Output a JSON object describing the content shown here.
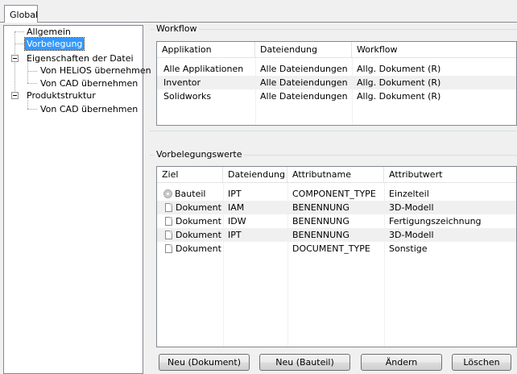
{
  "tab": {
    "label": "Global"
  },
  "tree": {
    "items": [
      {
        "label": "Allgemein"
      },
      {
        "label": "Vorbelegung"
      },
      {
        "label": "Eigenschaften der Datei"
      },
      {
        "label": "Von HELiOS übernehmen"
      },
      {
        "label": "Von CAD übernehmen"
      },
      {
        "label": "Produktstruktur"
      },
      {
        "label": "Von CAD übernehmen"
      }
    ]
  },
  "workflow": {
    "title": "Workflow",
    "columns": [
      "Applikation",
      "Dateiendung",
      "Workflow"
    ],
    "rows": [
      [
        "Alle Applikationen",
        "Alle Dateiendungen",
        "Allg. Dokument (R)"
      ],
      [
        "Inventor",
        "Alle Dateiendungen",
        "Allg. Dokument (R)"
      ],
      [
        "Solidworks",
        "Alle Dateiendungen",
        "Allg. Dokument (R)"
      ]
    ]
  },
  "presets": {
    "title": "Vorbelegungswerte",
    "columns": [
      "Ziel",
      "Dateiendung",
      "Attributname",
      "Attributwert"
    ],
    "rows": [
      {
        "icon": "gear-icon",
        "cells": [
          "Bauteil",
          "IPT",
          "COMPONENT_TYPE",
          "Einzelteil"
        ]
      },
      {
        "icon": "document-icon",
        "cells": [
          "Dokument",
          "IAM",
          "BENENNUNG",
          "3D-Modell"
        ]
      },
      {
        "icon": "document-icon",
        "cells": [
          "Dokument",
          "IDW",
          "BENENNUNG",
          "Fertigungszeichnung"
        ]
      },
      {
        "icon": "document-icon",
        "cells": [
          "Dokument",
          "IPT",
          "BENENNUNG",
          "3D-Modell"
        ]
      },
      {
        "icon": "document-icon",
        "cells": [
          "Dokument",
          "",
          "DOCUMENT_TYPE",
          "Sonstige"
        ]
      }
    ]
  },
  "buttons": {
    "new_document": "Neu (Dokument)",
    "new_part": "Neu (Bauteil)",
    "edit": "Ändern",
    "delete": "Löschen"
  }
}
